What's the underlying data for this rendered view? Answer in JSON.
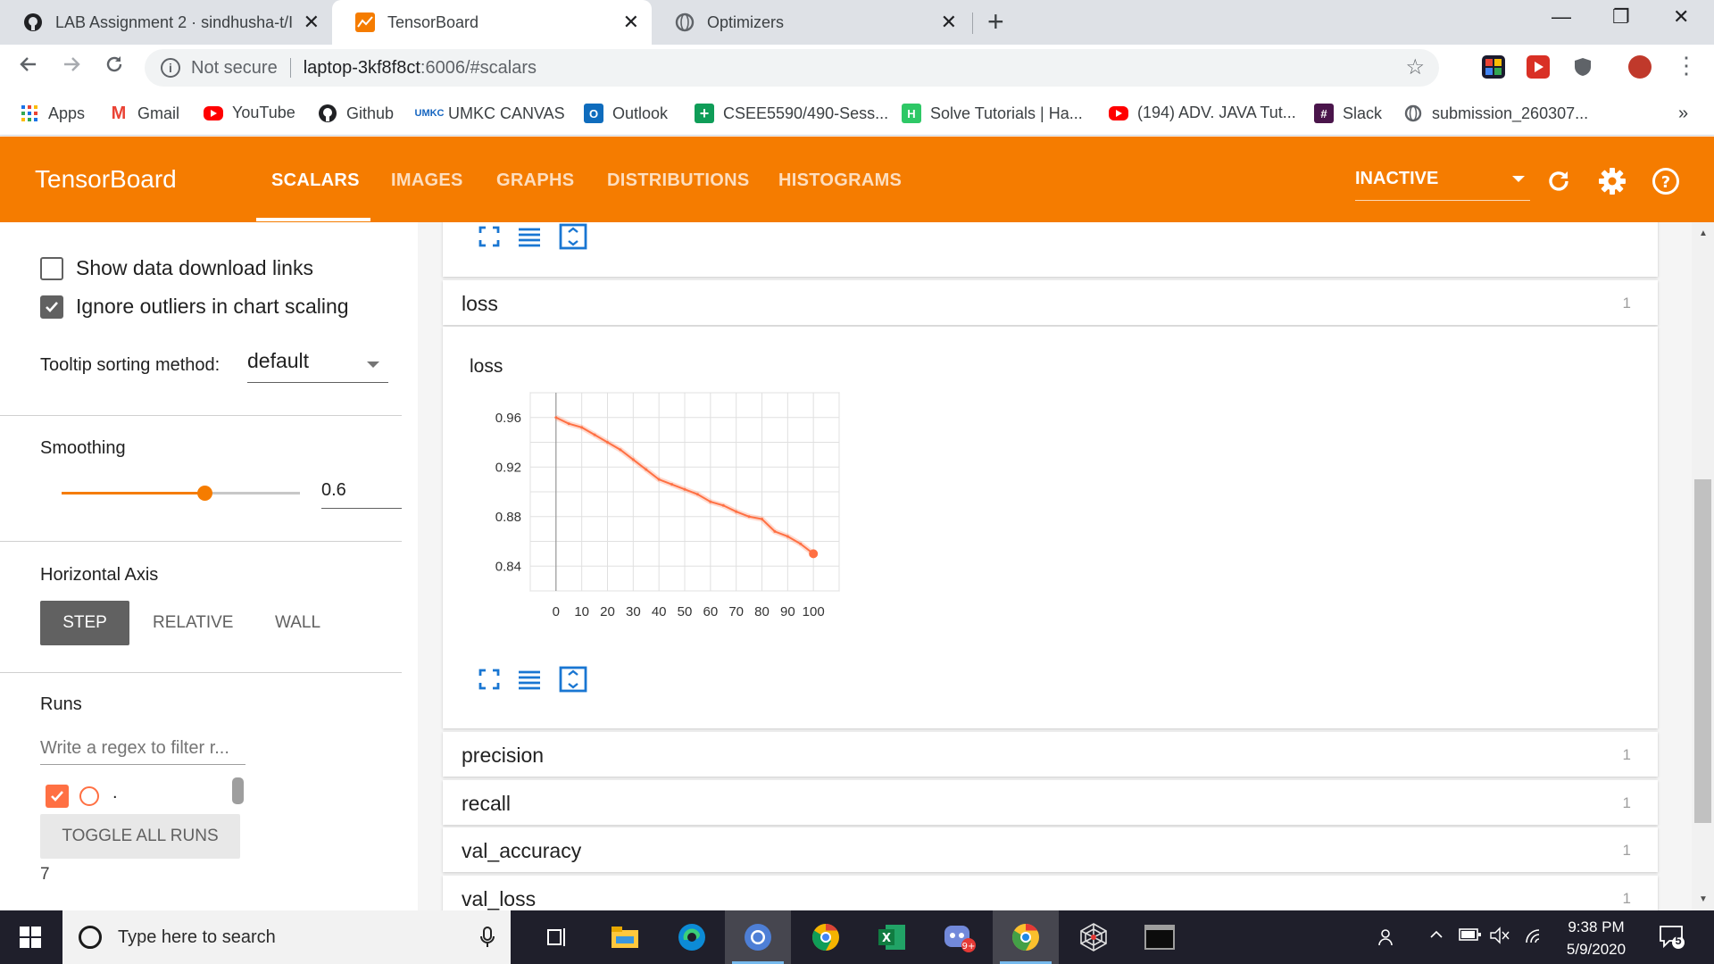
{
  "browser": {
    "tabs": [
      {
        "title": "LAB Assignment 2 · sindhusha-t/I",
        "close": "✕"
      },
      {
        "title": "TensorBoard",
        "close": "✕"
      },
      {
        "title": "Optimizers",
        "close": "✕"
      }
    ],
    "new_tab": "+",
    "window": {
      "minimize": "—",
      "restore": "❐",
      "close": "✕"
    },
    "security_label": "Not secure",
    "url_host": "laptop-3kf8f8ct",
    "url_rest": ":6006/#scalars",
    "bookmarks": [
      {
        "label": "Apps",
        "icon": "apps-grid-icon"
      },
      {
        "label": "Gmail",
        "icon": "gmail-icon"
      },
      {
        "label": "YouTube",
        "icon": "youtube-icon"
      },
      {
        "label": "Github",
        "icon": "github-icon"
      },
      {
        "label": "UMKC CANVAS",
        "icon": "umkc-icon"
      },
      {
        "label": "Outlook",
        "icon": "outlook-icon"
      },
      {
        "label": "CSEE5590/490-Sess...",
        "icon": "plus-sheet-icon"
      },
      {
        "label": "Solve Tutorials | Ha...",
        "icon": "hackerrank-icon"
      },
      {
        "label": "(194) ADV. JAVA Tut...",
        "icon": "youtube-icon"
      },
      {
        "label": "Slack",
        "icon": "slack-icon"
      },
      {
        "label": "submission_260307...",
        "icon": "globe-icon"
      }
    ],
    "more": "»"
  },
  "tensorboard": {
    "logo": "TensorBoard",
    "nav": [
      "SCALARS",
      "IMAGES",
      "GRAPHS",
      "DISTRIBUTIONS",
      "HISTOGRAMS"
    ],
    "status": "INACTIVE",
    "accent": "#f57c00"
  },
  "sidebar": {
    "show_download": "Show data download links",
    "ignore_outliers": "Ignore outliers in chart scaling",
    "tooltip_label": "Tooltip sorting method:",
    "tooltip_value": "default",
    "smoothing_label": "Smoothing",
    "smoothing_value": "0.6",
    "smoothing_fraction": 0.6,
    "axis_label": "Horizontal Axis",
    "axis_options": [
      "STEP",
      "RELATIVE",
      "WALL"
    ],
    "runs_label": "Runs",
    "runs_filter_placeholder": "Write a regex to filter r...",
    "run_name": ".",
    "toggle_all": "TOGGLE ALL RUNS",
    "footer_number": "7"
  },
  "main": {
    "loss_card": {
      "name": "loss",
      "count": "1",
      "chart_title": "loss"
    },
    "cards": [
      {
        "name": "precision",
        "count": "1"
      },
      {
        "name": "recall",
        "count": "1"
      },
      {
        "name": "val_accuracy",
        "count": "1"
      },
      {
        "name": "val_loss",
        "count": "1"
      }
    ]
  },
  "chart_data": {
    "type": "line",
    "title": "loss",
    "xlabel": "",
    "ylabel": "",
    "xlim": [
      -10,
      110
    ],
    "ylim": [
      0.82,
      0.98
    ],
    "xticks": [
      0,
      10,
      20,
      30,
      40,
      50,
      60,
      70,
      80,
      90,
      100
    ],
    "yticks": [
      0.84,
      0.88,
      0.92,
      0.96
    ],
    "ytick_labels": [
      "0.84",
      "0.88",
      "0.92",
      "0.96"
    ],
    "grid": true,
    "series": [
      {
        "color": "#ff7043",
        "x": [
          0,
          5,
          10,
          15,
          20,
          25,
          30,
          35,
          40,
          45,
          50,
          55,
          60,
          65,
          70,
          75,
          80,
          85,
          90,
          95,
          100
        ],
        "y": [
          0.96,
          0.955,
          0.952,
          0.946,
          0.94,
          0.934,
          0.926,
          0.918,
          0.91,
          0.906,
          0.902,
          0.898,
          0.892,
          0.889,
          0.884,
          0.88,
          0.878,
          0.868,
          0.864,
          0.858,
          0.85
        ]
      }
    ]
  },
  "taskbar": {
    "search_placeholder": "Type here to search",
    "time": "9:38 PM",
    "date": "5/9/2020",
    "notification_count": "5"
  }
}
